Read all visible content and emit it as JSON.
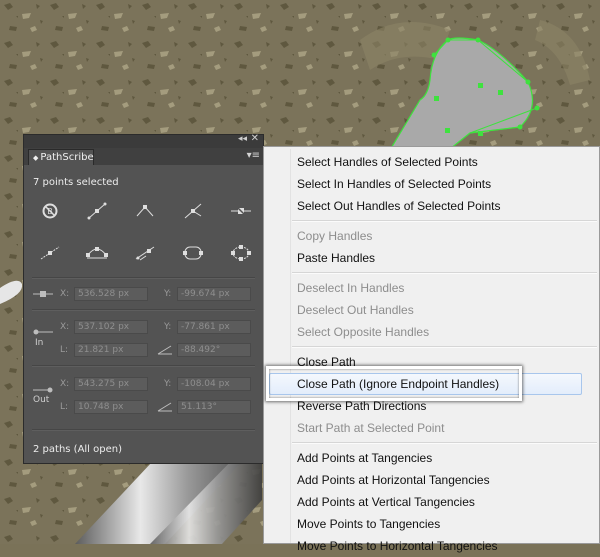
{
  "panel": {
    "tab_label": "PathScribe",
    "collapse_glyph": "◂◂",
    "close_glyph": "✕",
    "menu_glyph": "▾≡",
    "selection_status": "7 points selected",
    "point": {
      "x_label": "X:",
      "x_value": "536.528 px",
      "y_label": "Y:",
      "y_value": "-99.674 px"
    },
    "in_handle": {
      "side_label": "In",
      "x_label": "X:",
      "x_value": "537.102 px",
      "y_label": "Y:",
      "y_value": "-77.861 px",
      "length_label": "L:",
      "length_value": "21.821 px",
      "angle_value": "-88.492°"
    },
    "out_handle": {
      "side_label": "Out",
      "x_label": "X:",
      "x_value": "543.275 px",
      "y_label": "Y:",
      "y_value": "-108.04 px",
      "length_label": "L:",
      "length_value": "10.748 px",
      "angle_value": "51.113°"
    },
    "footer": "2 paths (All open)",
    "icons": [
      "no-handles-icon",
      "smooth-point-icon",
      "corner-point-icon",
      "cusp-point-icon",
      "remove-point-icon",
      "add-point-icon",
      "ellipse-path-icon",
      "reflect-handles-icon",
      "rounded-rect-icon",
      "circle-path-icon"
    ]
  },
  "menu": {
    "items": [
      {
        "label": "Select Handles of Selected Points",
        "enabled": true
      },
      {
        "label": "Select In Handles of Selected Points",
        "enabled": true
      },
      {
        "label": "Select Out Handles of Selected Points",
        "enabled": true
      },
      {
        "label": "Copy Handles",
        "enabled": false
      },
      {
        "label": "Paste Handles",
        "enabled": true
      },
      {
        "label": "Deselect In Handles",
        "enabled": false
      },
      {
        "label": "Deselect Out Handles",
        "enabled": false
      },
      {
        "label": "Select Opposite Handles",
        "enabled": false
      },
      {
        "label": "Close Path",
        "enabled": true
      },
      {
        "label": "Close Path (Ignore Endpoint Handles)",
        "enabled": true,
        "highlighted": true
      },
      {
        "label": "Reverse Path Directions",
        "enabled": true
      },
      {
        "label": "Start Path at Selected Point",
        "enabled": false
      },
      {
        "label": "Add Points at Tangencies",
        "enabled": true
      },
      {
        "label": "Add Points at Horizontal Tangencies",
        "enabled": true
      },
      {
        "label": "Add Points at Vertical Tangencies",
        "enabled": true
      },
      {
        "label": "Move Points to Tangencies",
        "enabled": true
      },
      {
        "label": "Move Points to Horizontal Tangencies",
        "enabled": true
      }
    ]
  },
  "colors": {
    "canvas": "#7a7258",
    "selection_green": "#3ee23e",
    "panel_bg": "#535353",
    "menu_bg": "#f0f0f0",
    "menu_highlight_border": "#a8c6ec"
  }
}
